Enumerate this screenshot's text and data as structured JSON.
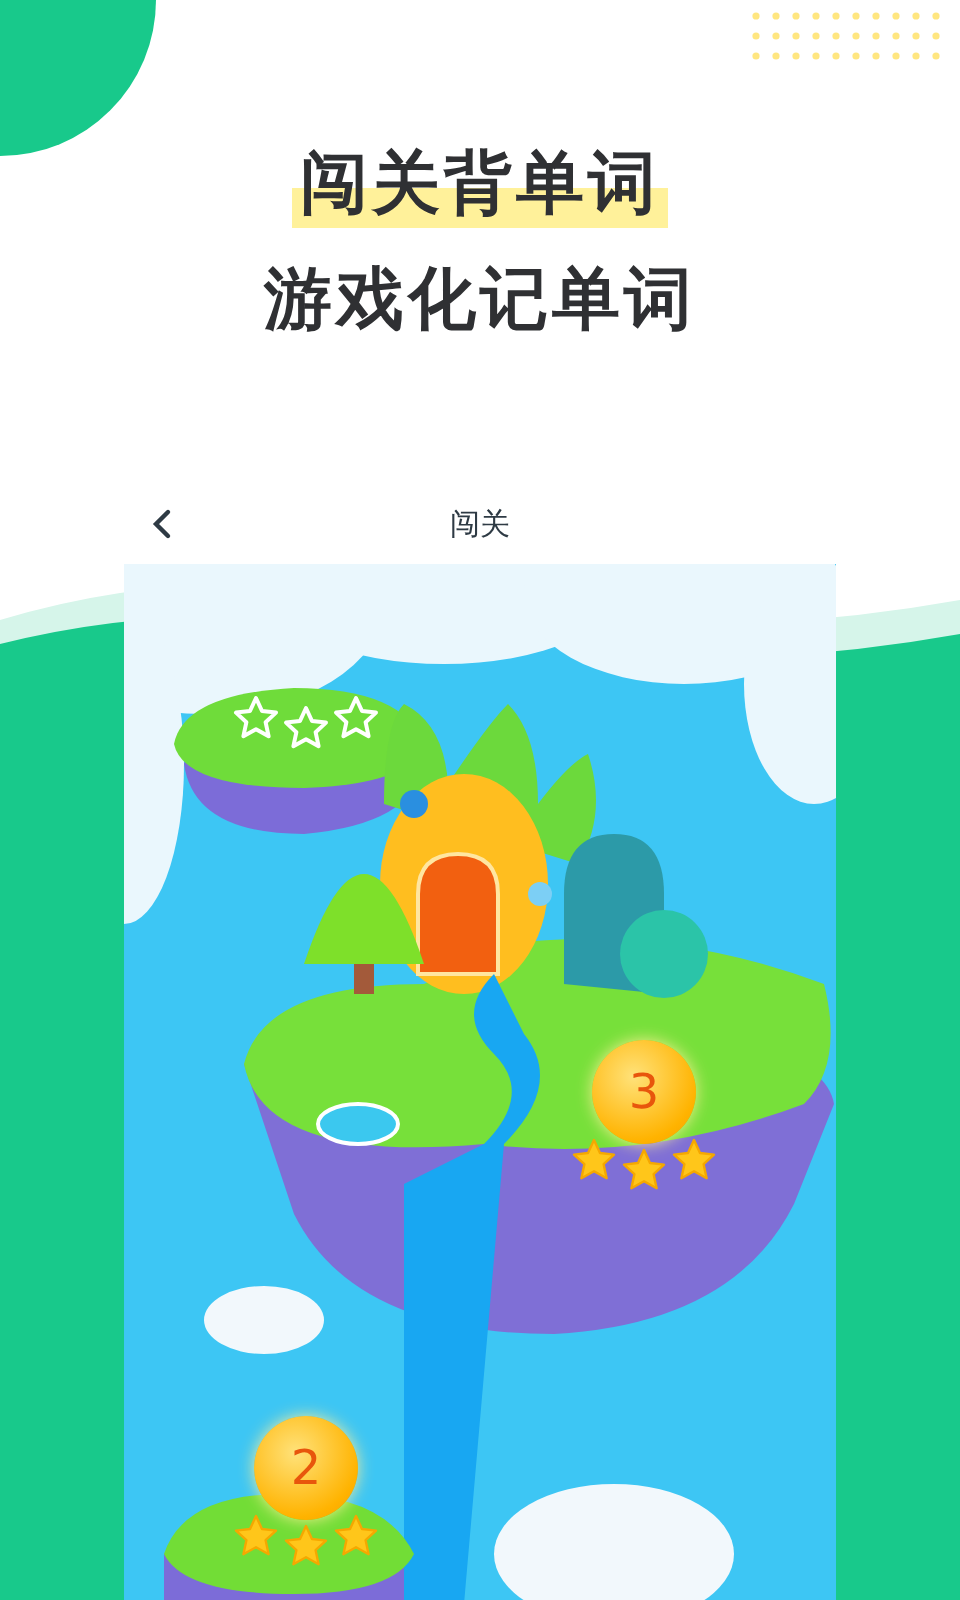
{
  "headline": {
    "lines": [
      {
        "text": "闯关背单词",
        "highlighted": true
      },
      {
        "text": "游戏化记单词",
        "highlighted": false
      }
    ]
  },
  "screen": {
    "title": "闯关",
    "levels": [
      {
        "stars": 0
      },
      {
        "number": "3",
        "stars": 3
      },
      {
        "number": "2",
        "stars": 3
      }
    ]
  }
}
